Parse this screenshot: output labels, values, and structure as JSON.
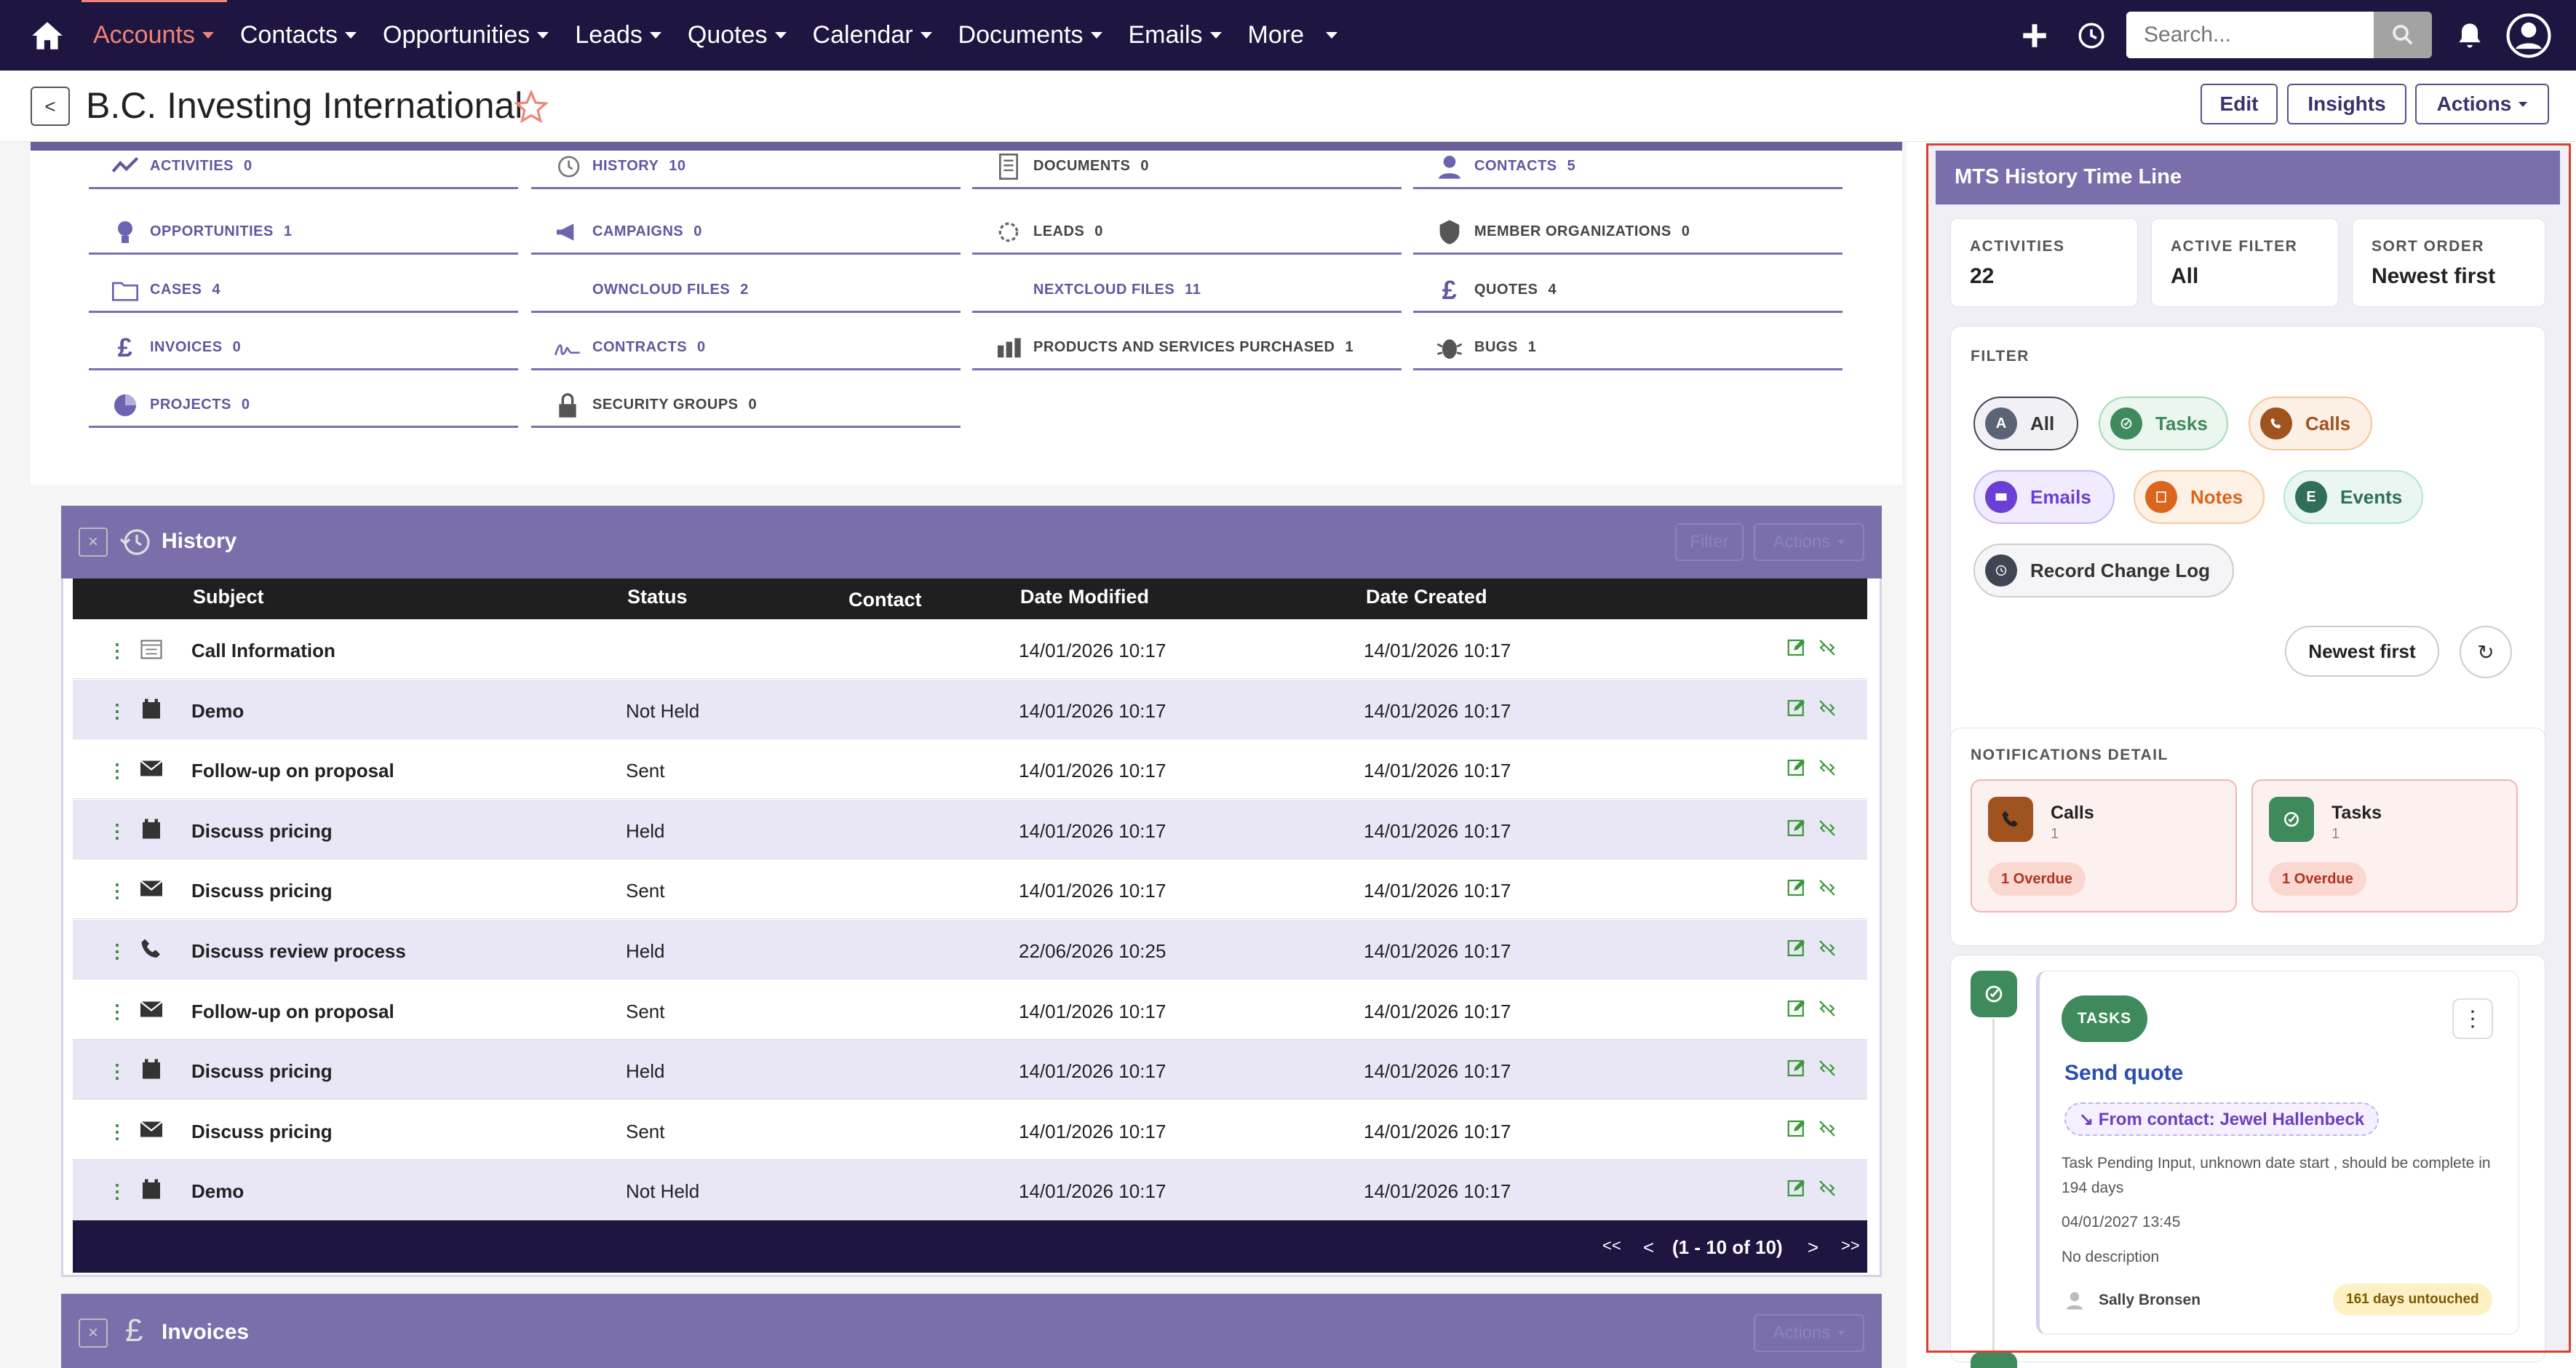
{
  "nav": {
    "items": [
      {
        "label": "Accounts",
        "active": true,
        "caret": true
      },
      {
        "label": "Contacts",
        "caret": true
      },
      {
        "label": "Opportunities",
        "caret": true
      },
      {
        "label": "Leads",
        "caret": true
      },
      {
        "label": "Quotes",
        "caret": true
      },
      {
        "label": "Calendar",
        "caret": true
      },
      {
        "label": "Documents",
        "caret": true
      },
      {
        "label": "Emails",
        "caret": true
      },
      {
        "label": "More",
        "caret": true
      }
    ],
    "search_placeholder": "Search...",
    "accent": "#f08377",
    "bg": "#1e1641"
  },
  "header": {
    "back": "<",
    "title": "B.C. Investing International",
    "buttons": {
      "edit": "Edit",
      "insights": "Insights",
      "actions": "Actions"
    }
  },
  "subpanels": [
    {
      "label": "ACTIVITIES",
      "count": "0",
      "icon": "activity-icon"
    },
    {
      "label": "HISTORY",
      "count": "10",
      "icon": "history-icon"
    },
    {
      "label": "DOCUMENTS",
      "count": "0",
      "icon": "document-icon",
      "dark": true
    },
    {
      "label": "CONTACTS",
      "count": "5",
      "icon": "contact-icon"
    },
    {
      "label": "OPPORTUNITIES",
      "count": "1",
      "icon": "lightbulb-icon"
    },
    {
      "label": "CAMPAIGNS",
      "count": "0",
      "icon": "megaphone-icon"
    },
    {
      "label": "LEADS",
      "count": "0",
      "icon": "leads-icon",
      "dark": true
    },
    {
      "label": "MEMBER ORGANIZATIONS",
      "count": "0",
      "icon": "shield-icon",
      "dark": true
    },
    {
      "label": "CASES",
      "count": "4",
      "icon": "folder-icon"
    },
    {
      "label": "OWNCLOUD FILES",
      "count": "2",
      "icon": ""
    },
    {
      "label": "NEXTCLOUD FILES",
      "count": "11",
      "icon": ""
    },
    {
      "label": "QUOTES",
      "count": "4",
      "icon": "pound-icon",
      "dark": true
    },
    {
      "label": "INVOICES",
      "count": "0",
      "icon": "pound-icon"
    },
    {
      "label": "CONTRACTS",
      "count": "0",
      "icon": "signature-icon"
    },
    {
      "label": "PRODUCTS AND SERVICES PURCHASED",
      "count": "1",
      "icon": "bars-icon",
      "dark": true
    },
    {
      "label": "BUGS",
      "count": "1",
      "icon": "bug-icon",
      "dark": true
    },
    {
      "label": "PROJECTS",
      "count": "0",
      "icon": "pie-icon"
    },
    {
      "label": "SECURITY GROUPS",
      "count": "0",
      "icon": "lock-icon",
      "dark": true
    }
  ],
  "history": {
    "title": "History",
    "filter_label": "Filter",
    "actions_label": "Actions",
    "columns": {
      "subject": "Subject",
      "status": "Status",
      "contact": "Contact",
      "date_modified": "Date Modified",
      "date_created": "Date Created"
    },
    "rows": [
      {
        "icon": "calendar-icon",
        "subject": "Call Information",
        "status": "",
        "date_modified": "14/01/2026 10:17",
        "date_created": "14/01/2026 10:17"
      },
      {
        "icon": "meeting-icon",
        "subject": "Demo",
        "status": "Not Held",
        "date_modified": "14/01/2026 10:17",
        "date_created": "14/01/2026 10:17"
      },
      {
        "icon": "email-icon",
        "subject": "Follow-up on proposal",
        "status": "Sent",
        "date_modified": "14/01/2026 10:17",
        "date_created": "14/01/2026 10:17"
      },
      {
        "icon": "meeting-icon",
        "subject": "Discuss pricing",
        "status": "Held",
        "date_modified": "14/01/2026 10:17",
        "date_created": "14/01/2026 10:17"
      },
      {
        "icon": "email-icon",
        "subject": "Discuss pricing",
        "status": "Sent",
        "date_modified": "14/01/2026 10:17",
        "date_created": "14/01/2026 10:17"
      },
      {
        "icon": "phone-icon",
        "subject": "Discuss review process",
        "status": "Held",
        "date_modified": "22/06/2026 10:25",
        "date_created": "14/01/2026 10:17"
      },
      {
        "icon": "email-icon",
        "subject": "Follow-up on proposal",
        "status": "Sent",
        "date_modified": "14/01/2026 10:17",
        "date_created": "14/01/2026 10:17"
      },
      {
        "icon": "meeting-icon",
        "subject": "Discuss pricing",
        "status": "Held",
        "date_modified": "14/01/2026 10:17",
        "date_created": "14/01/2026 10:17"
      },
      {
        "icon": "email-icon",
        "subject": "Discuss pricing",
        "status": "Sent",
        "date_modified": "14/01/2026 10:17",
        "date_created": "14/01/2026 10:17"
      },
      {
        "icon": "meeting-icon",
        "subject": "Demo",
        "status": "Not Held",
        "date_modified": "14/01/2026 10:17",
        "date_created": "14/01/2026 10:17"
      }
    ],
    "pager": {
      "first": "<<",
      "prev": "<",
      "range": "(1 - 10 of 10)",
      "next": ">",
      "last": ">>"
    }
  },
  "invoices": {
    "title": "Invoices",
    "actions_label": "Actions"
  },
  "timeline": {
    "title": "MTS History Time Line",
    "stats": [
      {
        "label": "ACTIVITIES",
        "value": "22"
      },
      {
        "label": "ACTIVE FILTER",
        "value": "All"
      },
      {
        "label": "SORT ORDER",
        "value": "Newest first"
      }
    ],
    "filter_label": "FILTER",
    "filters": [
      {
        "label": "All",
        "letter": "A",
        "color": "#5b6475"
      },
      {
        "label": "Tasks",
        "letter": "",
        "color": "#3f8a5c"
      },
      {
        "label": "Calls",
        "letter": "",
        "color": "#a0521f"
      },
      {
        "label": "Emails",
        "letter": "",
        "color": "#6b3fd6"
      },
      {
        "label": "Notes",
        "letter": "",
        "color": "#d9661c"
      },
      {
        "label": "Events",
        "letter": "E",
        "color": "#2f6f5a"
      },
      {
        "label": "Record Change Log",
        "letter": "",
        "color": "#3f4552"
      }
    ],
    "sort_button": "Newest first",
    "refresh": "↻",
    "notifications_label": "NOTIFICATIONS DETAIL",
    "notifications": [
      {
        "title": "Calls",
        "count": "1",
        "overdue": "1 Overdue",
        "color": "#a0521f"
      },
      {
        "title": "Tasks",
        "count": "1",
        "overdue": "1 Overdue",
        "color": "#3f8a5c"
      }
    ],
    "item": {
      "badge": "TASKS",
      "title": "Send quote",
      "from": "↘ From contact: Jewel Hallenbeck",
      "description": "Task Pending Input, unknown date start , should be complete in 194 days",
      "date": "04/01/2027 13:45",
      "no_description": "No description",
      "user": "Sally Bronsen",
      "untouched": "161 days untouched"
    }
  }
}
